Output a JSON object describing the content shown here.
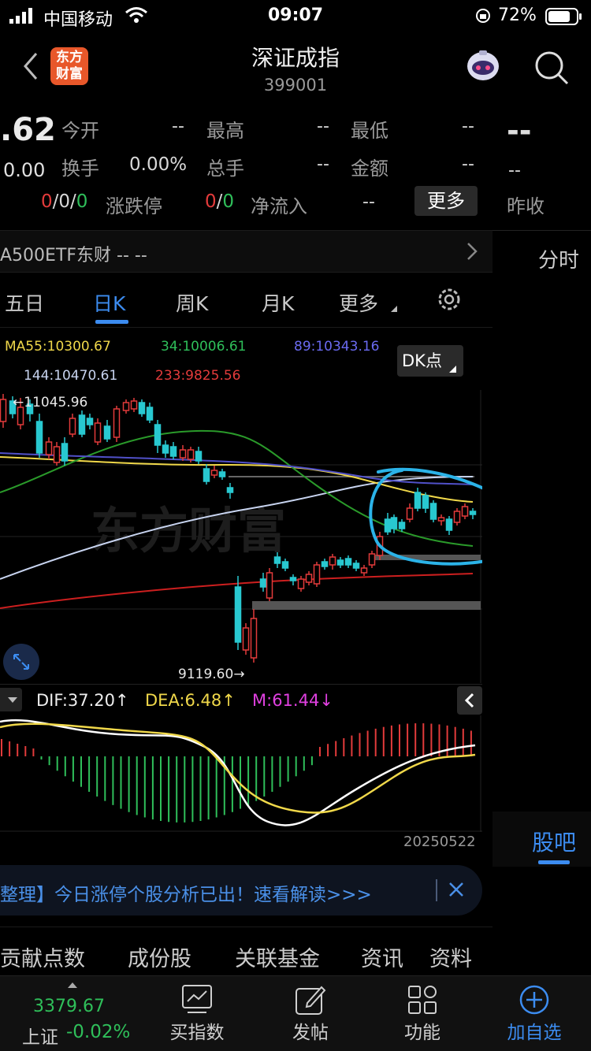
{
  "status_bar": {
    "carrier": "中国移动",
    "time": "09:07",
    "battery": "72%"
  },
  "header": {
    "title": "深证成指",
    "code": "399001",
    "logo_line1": "东方",
    "logo_line2": "财富"
  },
  "quote": {
    "price_fragment": ".62",
    "change_fragment": "0.00",
    "open_label": "今开",
    "open_value": "--",
    "high_label": "最高",
    "high_value": "--",
    "low_label": "最低",
    "low_value": "--",
    "turnover_label": "换手",
    "turnover_value": "0.00%",
    "volume_label": "总手",
    "volume_value": "--",
    "amount_label": "金额",
    "amount_value": "--",
    "limit_red": "0",
    "limit_sep1": "/",
    "limit_mid": "0",
    "limit_sep2": "/",
    "limit_green": "0",
    "limit_label": "涨跌停",
    "net_red": "0",
    "net_sep": "/",
    "net_green": "0",
    "netflow_label": "净流入",
    "netflow_value": "--",
    "more_button": "更多",
    "right_price": "--",
    "right_small": "--",
    "prev_close_label": "昨收"
  },
  "etf_row": {
    "text": "A500ETF东财 -- --"
  },
  "right_panel": {
    "fenshi_tab": "分时",
    "guba_tab": "股吧"
  },
  "period_tabs": [
    "五日",
    "日K",
    "周K",
    "月K",
    "更多"
  ],
  "ma_legend": {
    "ma55": "MA55:10300.67",
    "ma34": "34:10006.61",
    "ma89": "89:10343.16",
    "ma144": "144:10470.61",
    "ma233": "233:9825.56",
    "dk_button": "DK点"
  },
  "kline": {
    "high_label": "11045.96",
    "low_label": "9119.60",
    "watermark": "东方财富"
  },
  "macd_legend": {
    "dif": "DIF:37.20",
    "dea": "DEA:6.48",
    "m": "M:61.44"
  },
  "date_label": "20250522",
  "banner": {
    "text": "整理】今日涨停个股分析已出！速看解读>>>"
  },
  "section_tabs": [
    "贡献点数",
    "成份股",
    "关联基金",
    "资讯",
    "资料"
  ],
  "bottom_nav": {
    "index_price": "3379.67",
    "index_name": "上证",
    "index_change": "-0.02%",
    "items": [
      "买指数",
      "发帖",
      "功能",
      "加自选"
    ]
  },
  "colors": {
    "accent": "#3c8cf0",
    "up": "#e33b3b",
    "down": "#2fbf5a",
    "bull_candle": "#28c8d0"
  }
}
